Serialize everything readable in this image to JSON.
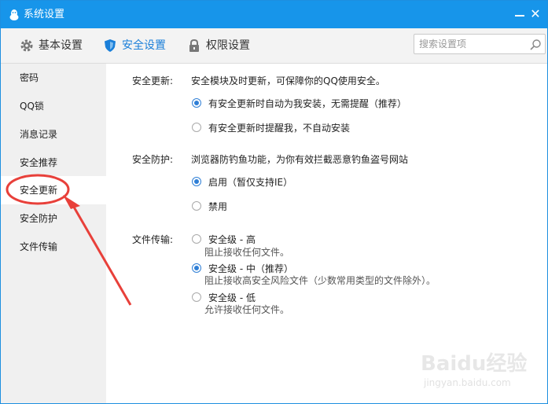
{
  "window": {
    "title": "系统设置"
  },
  "toolbar": {
    "tabs": [
      {
        "label": "基本设置",
        "icon": "gear-icon"
      },
      {
        "label": "安全设置",
        "icon": "shield-icon"
      },
      {
        "label": "权限设置",
        "icon": "lock-icon"
      }
    ],
    "search_placeholder": "搜索设置项"
  },
  "sidebar": {
    "items": [
      {
        "label": "密码"
      },
      {
        "label": "QQ锁"
      },
      {
        "label": "消息记录"
      },
      {
        "label": "安全推荐"
      },
      {
        "label": "安全更新",
        "active": true
      },
      {
        "label": "安全防护"
      },
      {
        "label": "文件传输"
      }
    ]
  },
  "sections": {
    "update": {
      "label": "安全更新:",
      "desc": "安全模块及时更新，可保障你的QQ使用安全。",
      "options": [
        {
          "label": "有安全更新时自动为我安装，无需提醒（推荐）",
          "selected": true
        },
        {
          "label": "有安全更新时提醒我，不自动安装",
          "selected": false
        }
      ]
    },
    "protect": {
      "label": "安全防护:",
      "desc": "浏览器防钓鱼功能，为你有效拦截恶意钓鱼盗号网站",
      "options": [
        {
          "label": "启用（暂仅支持IE）",
          "selected": true
        },
        {
          "label": "禁用",
          "selected": false
        }
      ]
    },
    "transfer": {
      "label": "文件传输:",
      "options": [
        {
          "label": "安全级 - 高",
          "sub": "阻止接收任何文件。",
          "selected": false
        },
        {
          "label": "安全级 - 中（推荐）",
          "sub": "阻止接收高安全风险文件（少数常用类型的文件除外）。",
          "selected": true
        },
        {
          "label": "安全级 - 低",
          "sub": "允许接收任何文件。",
          "selected": false
        }
      ]
    }
  },
  "watermark": {
    "text": "Baidu经验",
    "sub": "jingyan.baidu.com"
  },
  "colors": {
    "titlebar": "#1795ea",
    "accent": "#1a7fd9",
    "annotation": "#e8403a"
  }
}
